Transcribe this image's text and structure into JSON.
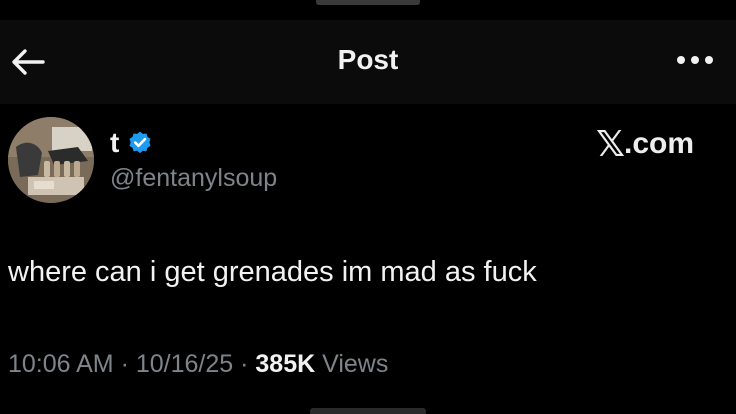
{
  "header": {
    "title": "Post",
    "back_icon": "arrow-left-icon",
    "more_icon": "more-horizontal-icon"
  },
  "author": {
    "display_name": "t",
    "handle": "@fentanylsoup",
    "verified_icon": "verified-badge-icon",
    "verified_color": "#1d9bf0"
  },
  "watermark": {
    "x_glyph": "𝕏",
    "suffix": ".com"
  },
  "post": {
    "text": "where can i get grenades im mad as fuck"
  },
  "meta": {
    "time": "10:06 AM",
    "separator": " · ",
    "date": "10/16/25",
    "views_count": "385K",
    "views_label": " Views"
  },
  "colors": {
    "background": "#000000",
    "header_background": "#0b0b0b",
    "primary_text": "#f2f2f2",
    "secondary_text": "#7e848a",
    "accent": "#1d9bf0"
  }
}
